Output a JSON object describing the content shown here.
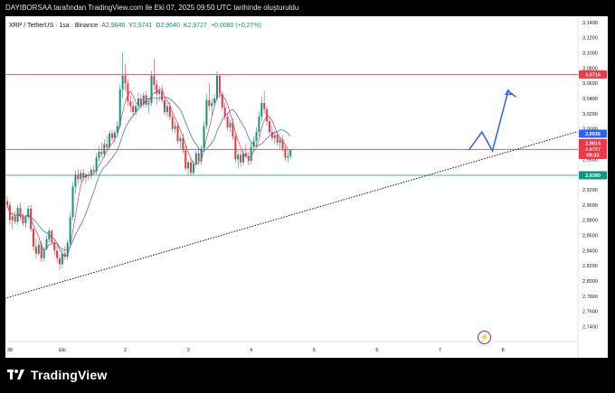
{
  "header": {
    "text": "DAYIBORSAA tarafından TradingView.com ile Eki 07, 2025 09:50 UTC tarihinde oluşturuldu"
  },
  "legend": {
    "symbol": "XRP / TetherUS · 1sa · Binance",
    "open_label": "A",
    "open": "2,9646",
    "high_label": "Y",
    "high": "2,9741",
    "low_label": "D",
    "low": "2,9640",
    "close_label": "K",
    "close": "2,9727",
    "change": "+0,0080 (+0,27%)"
  },
  "footer": {
    "brand": "TradingView"
  },
  "colors": {
    "up": "#089981",
    "down": "#f23645",
    "ma_fast": "#f23645",
    "ma_slow": "#2962ff",
    "resistance": "#f23645",
    "support": "#089981",
    "forecast": "#2962ff",
    "trendline": "#131722"
  },
  "chart_data": {
    "type": "candlestick",
    "symbol": "XRP / TetherUS",
    "interval": "1sa",
    "exchange": "Binance",
    "ylim": [
      2.7,
      3.15
    ],
    "y_ticks": [
      "3,1400",
      "3,1200",
      "3,1000",
      "3,0800",
      "3,0600",
      "3,0400",
      "3,0200",
      "3,0000",
      "2,9800",
      "2,9600",
      "2,9400",
      "2,9200",
      "2,9000",
      "2,8800",
      "2,8600",
      "2,8400",
      "2,8200",
      "2,8000",
      "2,7800",
      "2,7600",
      "2,7400"
    ],
    "y_tick_values": [
      3.14,
      3.12,
      3.1,
      3.08,
      3.06,
      3.04,
      3.02,
      3.0,
      2.98,
      2.96,
      2.94,
      2.92,
      2.9,
      2.88,
      2.86,
      2.84,
      2.82,
      2.8,
      2.78,
      2.76,
      2.74
    ],
    "x_ticks": [
      {
        "label": "30",
        "x": 1
      },
      {
        "label": "Eki",
        "x": 21
      },
      {
        "label": "2",
        "x": 45
      },
      {
        "label": "3",
        "x": 69
      },
      {
        "label": "4",
        "x": 93
      },
      {
        "label": "5",
        "x": 117
      },
      {
        "label": "6",
        "x": 141
      },
      {
        "label": "7",
        "x": 165
      },
      {
        "label": "8",
        "x": 189
      }
    ],
    "price_labels": [
      {
        "text": "3,0716",
        "value": 3.0716,
        "color": "#f23645"
      },
      {
        "text": "2,9936",
        "value": 2.9936,
        "color": "#2962ff"
      },
      {
        "text": "2,9814",
        "value": 2.9814,
        "color": "#f23645"
      },
      {
        "text": "2,9727",
        "value": 2.9727,
        "color": "#f23645"
      },
      {
        "text": "09:33",
        "value": 2.9657,
        "color": "#f23645"
      },
      {
        "text": "2,9390",
        "value": 2.939,
        "color": "#089981"
      }
    ],
    "hlines": [
      {
        "value": 3.0716,
        "color": "#f23645"
      },
      {
        "value": 2.9727,
        "color": "#f23645"
      },
      {
        "value": 2.939,
        "color": "#089981"
      }
    ],
    "trendline": {
      "x": [
        -2,
        217
      ],
      "y": [
        2.776,
        2.996
      ]
    },
    "forecast_path": {
      "x": [
        176,
        181,
        185,
        191,
        194
      ],
      "y": [
        2.972,
        2.996,
        2.971,
        3.05,
        3.042
      ]
    },
    "candles": [
      [
        2.905,
        2.912,
        2.895,
        2.9
      ],
      [
        2.9,
        2.904,
        2.874,
        2.88
      ],
      [
        2.88,
        2.89,
        2.868,
        2.885
      ],
      [
        2.885,
        2.892,
        2.875,
        2.878
      ],
      [
        2.878,
        2.9,
        2.874,
        2.896
      ],
      [
        2.896,
        2.903,
        2.88,
        2.885
      ],
      [
        2.885,
        2.889,
        2.872,
        2.876
      ],
      [
        2.876,
        2.887,
        2.87,
        2.884
      ],
      [
        2.884,
        2.899,
        2.88,
        2.895
      ],
      [
        2.895,
        2.9,
        2.864,
        2.868
      ],
      [
        2.868,
        2.87,
        2.84,
        2.845
      ],
      [
        2.845,
        2.856,
        2.83,
        2.836
      ],
      [
        2.836,
        2.852,
        2.833,
        2.848
      ],
      [
        2.848,
        2.853,
        2.825,
        2.83
      ],
      [
        2.83,
        2.845,
        2.826,
        2.842
      ],
      [
        2.842,
        2.86,
        2.84,
        2.855
      ],
      [
        2.855,
        2.87,
        2.85,
        2.866
      ],
      [
        2.866,
        2.868,
        2.848,
        2.851
      ],
      [
        2.851,
        2.856,
        2.834,
        2.84
      ],
      [
        2.84,
        2.846,
        2.824,
        2.83
      ],
      [
        2.83,
        2.836,
        2.814,
        2.822
      ],
      [
        2.822,
        2.84,
        2.817,
        2.836
      ],
      [
        2.836,
        2.846,
        2.828,
        2.832
      ],
      [
        2.832,
        2.854,
        2.828,
        2.85
      ],
      [
        2.85,
        2.89,
        2.846,
        2.884
      ],
      [
        2.884,
        2.93,
        2.88,
        2.924
      ],
      [
        2.924,
        2.945,
        2.915,
        2.94
      ],
      [
        2.94,
        2.947,
        2.928,
        2.934
      ],
      [
        2.934,
        2.946,
        2.93,
        2.942
      ],
      [
        2.942,
        2.947,
        2.932,
        2.936
      ],
      [
        2.936,
        2.942,
        2.928,
        2.94
      ],
      [
        2.94,
        2.944,
        2.932,
        2.938
      ],
      [
        2.938,
        2.95,
        2.934,
        2.946
      ],
      [
        2.946,
        2.952,
        2.94,
        2.944
      ],
      [
        2.944,
        2.968,
        2.94,
        2.962
      ],
      [
        2.962,
        2.977,
        2.958,
        2.97
      ],
      [
        2.97,
        2.982,
        2.963,
        2.967
      ],
      [
        2.967,
        2.986,
        2.962,
        2.98
      ],
      [
        2.98,
        2.992,
        2.972,
        2.976
      ],
      [
        2.976,
        2.998,
        2.972,
        2.994
      ],
      [
        2.994,
        2.999,
        2.984,
        2.988
      ],
      [
        2.988,
        2.999,
        2.982,
        2.995
      ],
      [
        2.995,
        3.01,
        2.99,
        3.004
      ],
      [
        3.004,
        3.058,
        3.0,
        3.052
      ],
      [
        3.052,
        3.1,
        3.04,
        3.07
      ],
      [
        3.07,
        3.085,
        3.05,
        3.06
      ],
      [
        3.06,
        3.066,
        3.03,
        3.036
      ],
      [
        3.036,
        3.044,
        3.022,
        3.03
      ],
      [
        3.03,
        3.036,
        3.016,
        3.022
      ],
      [
        3.022,
        3.034,
        3.018,
        3.03
      ],
      [
        3.03,
        3.048,
        3.024,
        3.04
      ],
      [
        3.04,
        3.046,
        3.026,
        3.032
      ],
      [
        3.032,
        3.048,
        3.028,
        3.044
      ],
      [
        3.044,
        3.05,
        3.028,
        3.032
      ],
      [
        3.032,
        3.04,
        3.02,
        3.034
      ],
      [
        3.034,
        3.076,
        3.03,
        3.07
      ],
      [
        3.07,
        3.092,
        3.052,
        3.058
      ],
      [
        3.058,
        3.064,
        3.032,
        3.046
      ],
      [
        3.046,
        3.056,
        3.036,
        3.05
      ],
      [
        3.05,
        3.058,
        3.034,
        3.038
      ],
      [
        3.038,
        3.042,
        3.018,
        3.022
      ],
      [
        3.022,
        3.034,
        3.016,
        3.03
      ],
      [
        3.03,
        3.036,
        3.012,
        3.016
      ],
      [
        3.016,
        3.02,
        2.996,
        3.0
      ],
      [
        3.0,
        3.01,
        2.994,
        3.004
      ],
      [
        3.004,
        3.008,
        2.98,
        2.984
      ],
      [
        2.984,
        2.992,
        2.974,
        2.988
      ],
      [
        2.988,
        2.994,
        2.968,
        2.972
      ],
      [
        2.972,
        2.978,
        2.944,
        2.948
      ],
      [
        2.948,
        2.96,
        2.94,
        2.956
      ],
      [
        2.956,
        2.962,
        2.938,
        2.942
      ],
      [
        2.942,
        2.958,
        2.94,
        2.954
      ],
      [
        2.954,
        2.972,
        2.95,
        2.968
      ],
      [
        2.968,
        2.976,
        2.952,
        2.958
      ],
      [
        2.958,
        2.978,
        2.954,
        2.974
      ],
      [
        2.974,
        3.01,
        2.97,
        3.004
      ],
      [
        3.004,
        3.046,
        3.0,
        3.038
      ],
      [
        3.038,
        3.06,
        3.024,
        3.03
      ],
      [
        3.03,
        3.04,
        3.018,
        3.034
      ],
      [
        3.034,
        3.046,
        3.028,
        3.04
      ],
      [
        3.04,
        3.076,
        3.036,
        3.07
      ],
      [
        3.07,
        3.072,
        3.04,
        3.046
      ],
      [
        3.046,
        3.05,
        3.024,
        3.028
      ],
      [
        3.028,
        3.034,
        3.012,
        3.016
      ],
      [
        3.016,
        3.02,
        2.998,
        3.002
      ],
      [
        3.002,
        3.012,
        2.996,
        3.008
      ],
      [
        3.008,
        3.014,
        2.986,
        2.99
      ],
      [
        2.99,
        2.994,
        2.956,
        2.96
      ],
      [
        2.96,
        2.972,
        2.948,
        2.966
      ],
      [
        2.966,
        2.972,
        2.95,
        2.956
      ],
      [
        2.956,
        2.972,
        2.952,
        2.968
      ],
      [
        2.968,
        2.98,
        2.962,
        2.964
      ],
      [
        2.964,
        2.97,
        2.952,
        2.958
      ],
      [
        2.958,
        2.982,
        2.954,
        2.976
      ],
      [
        2.976,
        2.99,
        2.97,
        2.984
      ],
      [
        2.984,
        3.002,
        2.976,
        2.996
      ],
      [
        2.996,
        3.022,
        2.99,
        3.016
      ],
      [
        3.016,
        3.042,
        3.01,
        3.034
      ],
      [
        3.034,
        3.05,
        3.02,
        3.026
      ],
      [
        3.026,
        3.03,
        3.004,
        3.01
      ],
      [
        3.01,
        3.016,
        2.992,
        2.996
      ],
      [
        2.996,
        3.004,
        2.984,
        2.988
      ],
      [
        2.988,
        2.998,
        2.98,
        2.992
      ],
      [
        2.992,
        2.996,
        2.978,
        2.982
      ],
      [
        2.982,
        2.99,
        2.974,
        2.986
      ],
      [
        2.986,
        2.992,
        2.97,
        2.974
      ],
      [
        2.974,
        2.98,
        2.958,
        2.962
      ],
      [
        2.962,
        2.974,
        2.956,
        2.964
      ],
      [
        2.964,
        2.974,
        2.96,
        2.9727
      ]
    ]
  }
}
